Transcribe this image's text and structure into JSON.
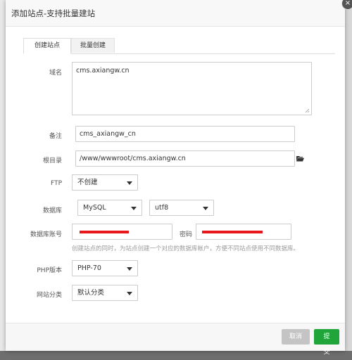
{
  "dialog": {
    "title": "添加站点-支持批量建站",
    "close_glyph": "×"
  },
  "tabs": [
    {
      "label": "创建站点",
      "active": true
    },
    {
      "label": "批量创建",
      "active": false
    }
  ],
  "form": {
    "domain": {
      "label": "域名",
      "value": "cms.axiangw.cn"
    },
    "remark": {
      "label": "备注",
      "value": "cms_axiangw_cn"
    },
    "root": {
      "label": "根目录",
      "value": "/www/wwwroot/cms.axiangw.cn",
      "icon": "folder-open-icon"
    },
    "ftp": {
      "label": "FTP",
      "selected": "不创建"
    },
    "database": {
      "label": "数据库",
      "type_selected": "MySQL",
      "charset_selected": "utf8"
    },
    "db_account": {
      "label": "数据库账号",
      "password_label": "密码"
    },
    "db_hint": "创建站点的同时，为站点创建一个对应的数据库帐户，方便不同站点使用不同数据库。",
    "php": {
      "label": "PHP版本",
      "selected": "PHP-70"
    },
    "category": {
      "label": "网站分类",
      "selected": "默认分类"
    }
  },
  "footer": {
    "cancel_label": "取消",
    "submit_label": "提交"
  },
  "colors": {
    "submit": "#20a53a",
    "cancel": "#c4c4c4",
    "redaction": "#e8171b"
  }
}
